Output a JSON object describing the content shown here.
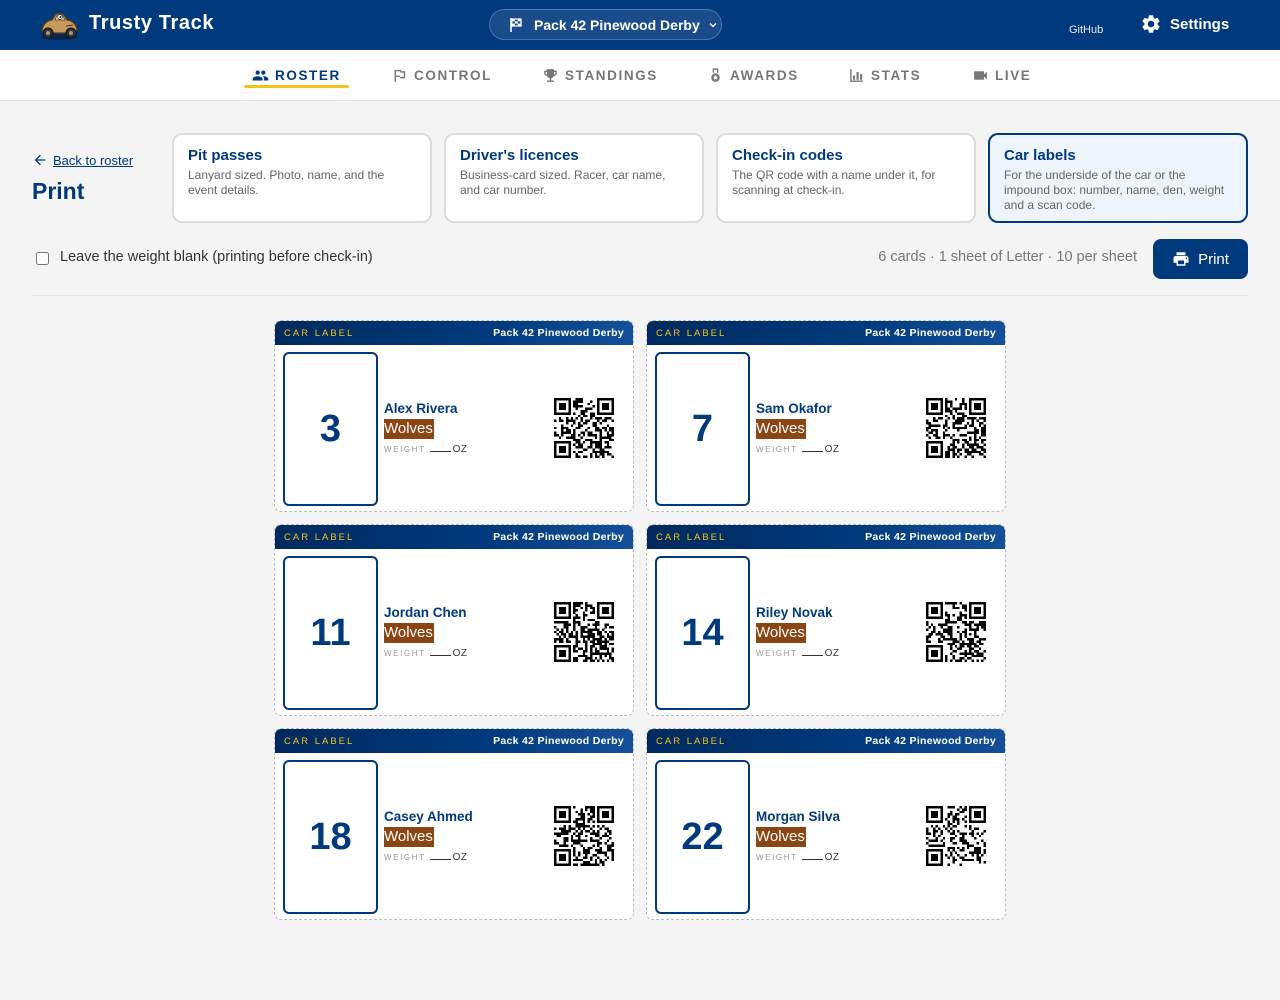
{
  "app": {
    "title": "Trusty Track",
    "event_name": "Pack 42 Pinewood Derby",
    "github_label": "GitHub",
    "settings_label": "Settings"
  },
  "tabs": [
    {
      "label": "ROSTER",
      "icon": "people-icon",
      "active": true
    },
    {
      "label": "CONTROL",
      "icon": "flag-icon",
      "active": false
    },
    {
      "label": "STANDINGS",
      "icon": "trophy-icon",
      "active": false
    },
    {
      "label": "AWARDS",
      "icon": "medal-icon",
      "active": false
    },
    {
      "label": "STATS",
      "icon": "bar-chart-icon",
      "active": false
    },
    {
      "label": "LIVE",
      "icon": "video-icon",
      "active": false
    }
  ],
  "page": {
    "back_label": "Back to roster",
    "title": "Print"
  },
  "options": [
    {
      "title": "Pit passes",
      "desc": "Lanyard sized. Photo, name, and the event details.",
      "selected": false
    },
    {
      "title": "Driver's licences",
      "desc": "Business-card sized. Racer, car name, and car number.",
      "selected": false
    },
    {
      "title": "Check-in codes",
      "desc": "The QR code with a name under it, for scanning at check-in.",
      "selected": false
    },
    {
      "title": "Car labels",
      "desc": "For the underside of the car or the impound box: number, name, den, weight and a scan code.",
      "selected": true
    }
  ],
  "controls": {
    "weight_checkbox_label": "Leave the weight blank (printing before check-in)",
    "weight_checkbox_checked": false,
    "summary": "6 cards · 1 sheet of Letter · 10 per sheet",
    "print_label": "Print"
  },
  "label_common": {
    "kind": "CAR LABEL",
    "event": "Pack 42 Pinewood Derby",
    "weight_label": "WEIGHT",
    "weight_unit": "OZ"
  },
  "labels": [
    {
      "number": "3",
      "racer": "Alex Rivera",
      "den": "Wolves"
    },
    {
      "number": "7",
      "racer": "Sam Okafor",
      "den": "Wolves"
    },
    {
      "number": "11",
      "racer": "Jordan Chen",
      "den": "Wolves"
    },
    {
      "number": "14",
      "racer": "Riley Novak",
      "den": "Wolves"
    },
    {
      "number": "18",
      "racer": "Casey Ahmed",
      "den": "Wolves"
    },
    {
      "number": "22",
      "racer": "Morgan Silva",
      "den": "Wolves"
    }
  ],
  "colors": {
    "brand": "#003a7d",
    "accent": "#f2c318",
    "den_badge": "#8a4513"
  }
}
